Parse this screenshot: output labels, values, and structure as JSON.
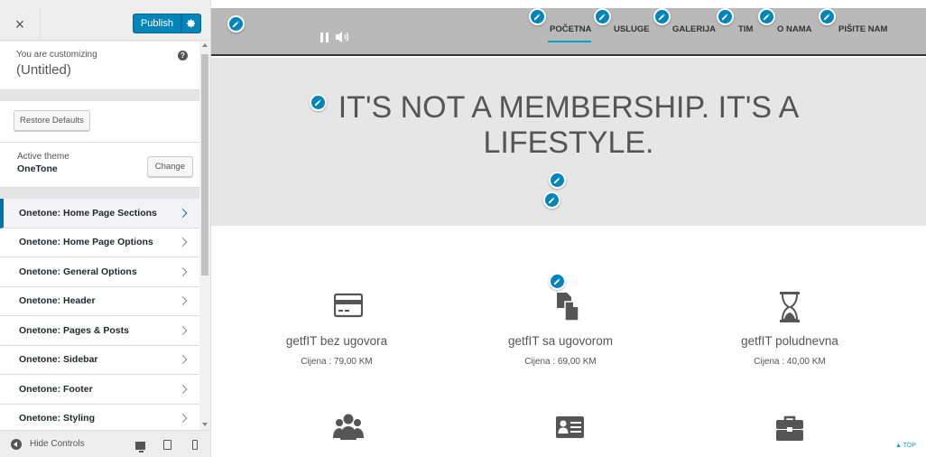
{
  "sidebar": {
    "close_label": "×",
    "publish_label": "Publish",
    "customizing_label": "You are customizing",
    "site_title": "(Untitled)",
    "restore_label": "Restore Defaults",
    "active_theme_label": "Active theme",
    "active_theme_name": "OneTone",
    "change_label": "Change",
    "panels": [
      {
        "label": "Onetone: Home Page Sections",
        "active": true
      },
      {
        "label": "Onetone: Home Page Options",
        "active": false
      },
      {
        "label": "Onetone: General Options",
        "active": false
      },
      {
        "label": "Onetone: Header",
        "active": false
      },
      {
        "label": "Onetone: Pages & Posts",
        "active": false
      },
      {
        "label": "Onetone: Sidebar",
        "active": false
      },
      {
        "label": "Onetone: Footer",
        "active": false
      },
      {
        "label": "Onetone: Styling",
        "active": false
      }
    ],
    "hide_controls_label": "Hide Controls"
  },
  "preview": {
    "nav": [
      "POČETNA",
      "USLUGE",
      "GALERIJA",
      "TIM",
      "O NAMA",
      "PIŠITE NAM"
    ],
    "active_nav": "POČETNA",
    "hero_title_line1": "IT'S NOT A MEMBERSHIP. IT'S A",
    "hero_title_line2": "LIFESTYLE.",
    "services": [
      {
        "name": "getfIT bez ugovora",
        "price": "Cijena : 79,00 KM",
        "icon": "credit-card-icon"
      },
      {
        "name": "getfIT sa ugovorom",
        "price": "Cijena : 69,00 KM",
        "icon": "documents-icon"
      },
      {
        "name": "getfIT poludnevna",
        "price": "Cijena : 40,00 KM",
        "icon": "hourglass-icon"
      }
    ],
    "services_row2_icons": [
      "users-icon",
      "id-card-icon",
      "briefcase-icon"
    ],
    "top_label": "TOP"
  },
  "colors": {
    "accent": "#0085ba",
    "nav_active": "#00a3d3",
    "nav_bg": "#b9b9b9",
    "hero_bg": "#e6e6e6"
  }
}
